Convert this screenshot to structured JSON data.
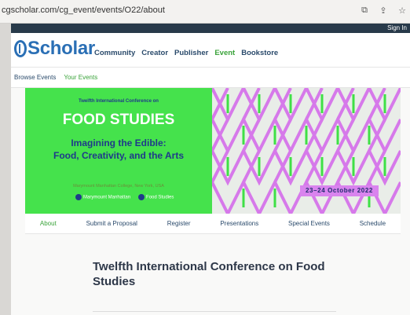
{
  "browser": {
    "url": "cgscholar.com/cg_event/events/O22/about",
    "icons": [
      "translate-icon",
      "share-icon",
      "bookmark-star-icon"
    ]
  },
  "topbar": {
    "sign_in": "Sign In"
  },
  "header": {
    "logo_text": "Scholar",
    "nav": [
      "Community",
      "Creator",
      "Publisher",
      "Event",
      "Bookstore"
    ],
    "active_nav": "Event"
  },
  "subnav": {
    "browse": "Browse Events",
    "yours": "Your Events"
  },
  "banner": {
    "kicker": "Twelfth International Conference on",
    "title": "FOOD STUDIES",
    "theme_line1": "Imagining the Edible:",
    "theme_line2": "Food, Creativity, and the Arts",
    "venue": "Marymount Manhattan College, New York, USA",
    "logo1": "Marymount Manhattan",
    "logo2": "Food Studies",
    "dates": "23–24 October 2022",
    "colors": {
      "green": "#45e24c",
      "purple": "#d984ee",
      "navy": "#1f3a8a"
    }
  },
  "event_nav": {
    "items": [
      "About",
      "Submit a Proposal",
      "Register",
      "Presentations",
      "Special Events",
      "Schedule"
    ],
    "active": "About"
  },
  "content": {
    "title": "Twelfth International Conference on Food Studies"
  }
}
